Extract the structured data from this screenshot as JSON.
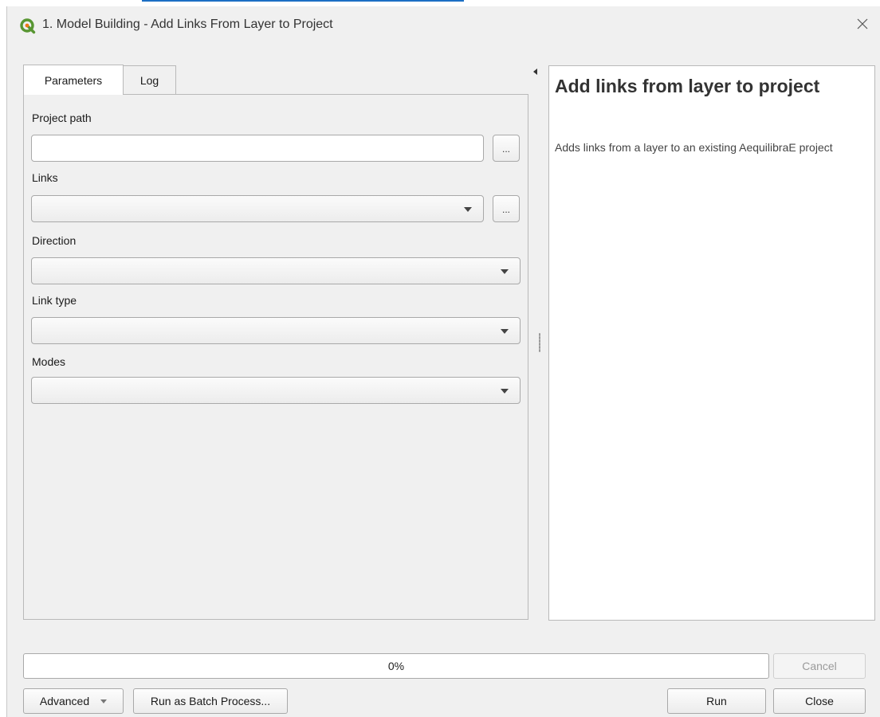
{
  "window": {
    "title": "1. Model Building - Add Links From Layer to Project"
  },
  "tabs": [
    {
      "label": "Parameters",
      "active": true
    },
    {
      "label": "Log",
      "active": false
    }
  ],
  "params": {
    "project_path": {
      "label": "Project path",
      "value": "",
      "browse_label": "..."
    },
    "links": {
      "label": "Links",
      "value": "",
      "button_label": "..."
    },
    "direction": {
      "label": "Direction",
      "value": ""
    },
    "link_type": {
      "label": "Link type",
      "value": ""
    },
    "modes": {
      "label": "Modes",
      "value": ""
    }
  },
  "help": {
    "title": "Add links from layer to project",
    "description": "Adds links from a layer to an existing AequilibraE project"
  },
  "progress": {
    "value": 0,
    "text": "0%"
  },
  "buttons": {
    "cancel": "Cancel",
    "advanced": "Advanced",
    "batch": "Run as Batch Process...",
    "run": "Run",
    "close": "Close"
  },
  "colors": {
    "qgis_green": "#589632",
    "qgis_yellow": "#ee7913",
    "accent": "#1c6fc4"
  },
  "icons": {
    "app": "qgis-logo-icon",
    "close": "close-icon",
    "collapse": "collapse-arrow-icon"
  }
}
